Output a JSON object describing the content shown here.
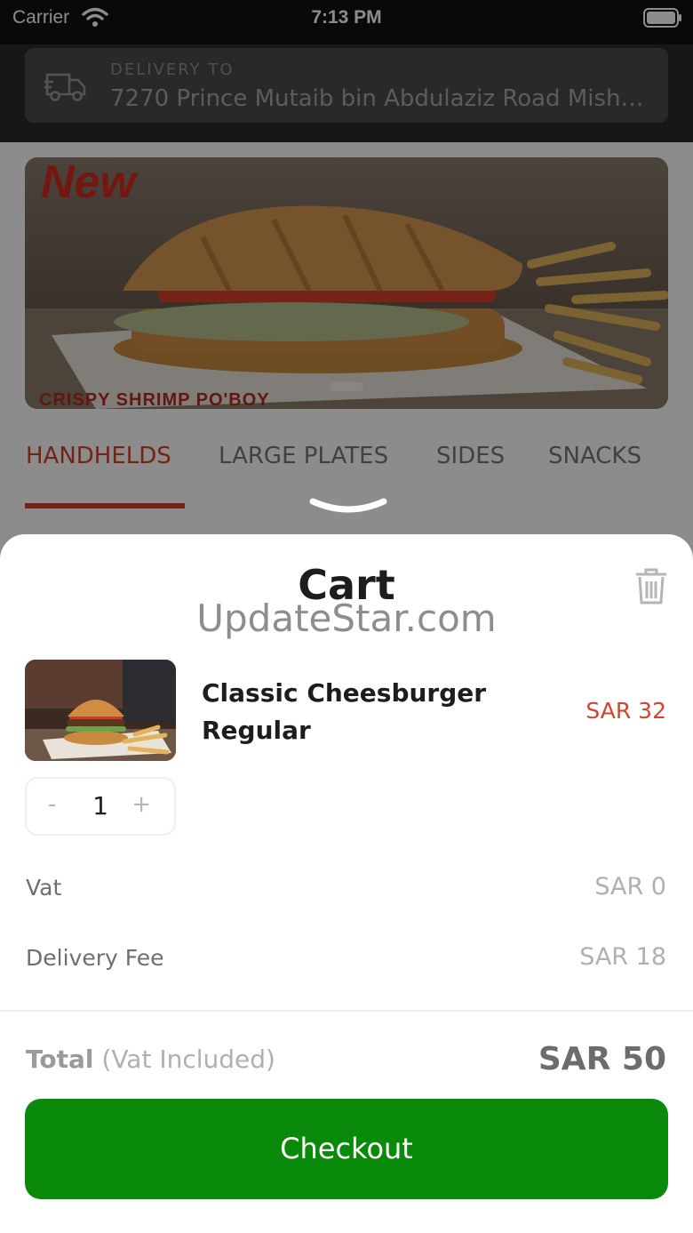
{
  "status_bar": {
    "carrier": "Carrier",
    "time": "7:13 PM"
  },
  "header": {
    "delivery_label": "DELIVERY TO",
    "delivery_address": "7270 Prince Mutaib bin Abdulaziz Road Mishri..."
  },
  "banner": {
    "headline": "New",
    "subtitle": "CRISPY SHRIMP PO'BOY"
  },
  "tabs": [
    {
      "label": "HANDHELDS",
      "active": true
    },
    {
      "label": "LARGE PLATES",
      "active": false
    },
    {
      "label": "SIDES",
      "active": false
    },
    {
      "label": "SNACKS",
      "active": false
    }
  ],
  "cart": {
    "title": "Cart",
    "watermark": "UpdateStar.com",
    "item": {
      "name": "Classic Cheesburger Regular",
      "price": "SAR 32",
      "quantity": "1",
      "minus_label": "-",
      "plus_label": "+"
    },
    "vat_label": "Vat",
    "vat_value": "SAR 0",
    "delivery_fee_label": "Delivery Fee",
    "delivery_fee_value": "SAR 18",
    "total_label": "Total",
    "total_note": "(Vat Included)",
    "total_value": "SAR 50",
    "checkout_label": "Checkout"
  },
  "colors": {
    "accent": "#d8412b",
    "checkout": "#0a8a0a",
    "header": "#2a2a2a"
  }
}
